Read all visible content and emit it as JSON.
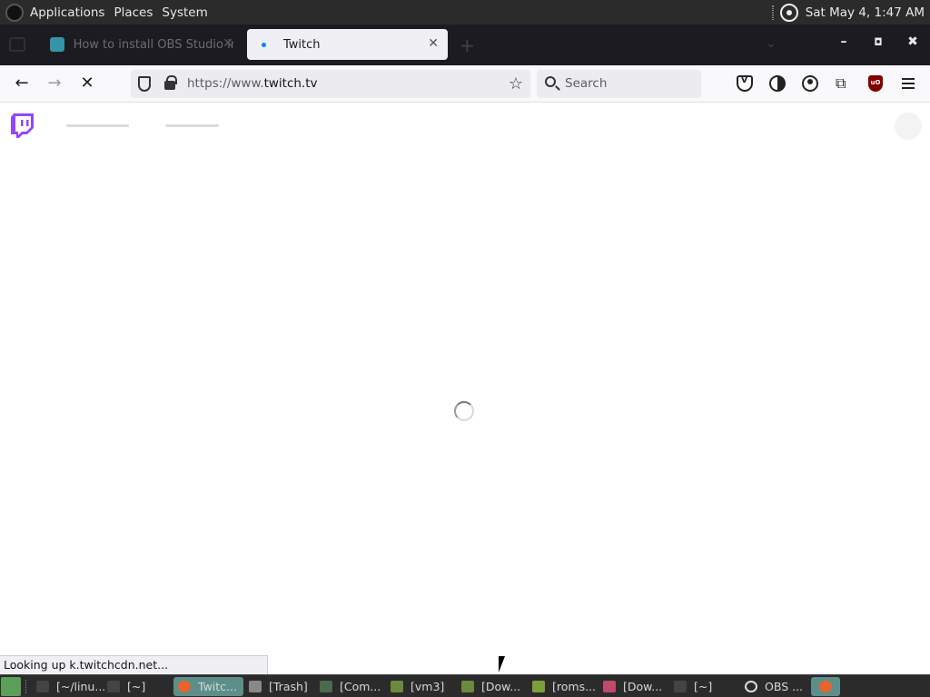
{
  "top_panel": {
    "menus": [
      "Applications",
      "Places",
      "System"
    ],
    "clock": "Sat May 4,  1:47 AM"
  },
  "browser": {
    "tabs": [
      {
        "title": "How to install OBS Studio in",
        "active": false
      },
      {
        "title": "Twitch",
        "active": true
      }
    ],
    "url_prefix": "https://www.",
    "url_domain": "twitch.tv",
    "search_placeholder": "Search",
    "status_text": "Looking up k.twitchcdn.net..."
  },
  "page": {
    "brand_color": "#9146ff"
  },
  "taskbar": {
    "items": [
      {
        "label": "[~/linu...",
        "icon": "terminal-icon",
        "active": false
      },
      {
        "label": "[~]",
        "icon": "terminal-icon",
        "active": false
      },
      {
        "label": "Twitc...",
        "icon": "firefox-icon",
        "active": true
      },
      {
        "label": "[Trash]",
        "icon": "trash-icon",
        "active": false
      },
      {
        "label": "[Com...",
        "icon": "computer-icon",
        "active": false
      },
      {
        "label": "[vm3]",
        "icon": "folder-icon",
        "active": false
      },
      {
        "label": "[Dow...",
        "icon": "folder-icon",
        "active": false
      },
      {
        "label": "[roms...",
        "icon": "folder-icon",
        "active": false
      },
      {
        "label": "[Dow...",
        "icon": "app-icon",
        "active": false
      },
      {
        "label": "[~]",
        "icon": "terminal-icon",
        "active": false
      },
      {
        "label": "OBS ...",
        "icon": "obs-icon",
        "active": false
      }
    ]
  }
}
